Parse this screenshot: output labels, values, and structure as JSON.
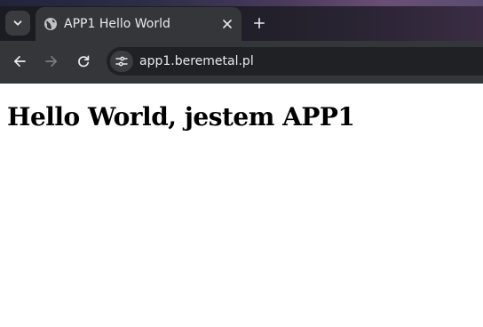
{
  "tabs": [
    {
      "title": "APP1 Hello World",
      "favicon": "globe-icon",
      "active": true
    }
  ],
  "toolbar": {
    "url": "app1.beremetal.pl"
  },
  "icons": {
    "tab_search": "chevron-down-icon",
    "close_tab": "close-icon",
    "new_tab": "plus-icon",
    "back": "arrow-left-icon",
    "forward": "arrow-right-icon",
    "reload": "reload-icon",
    "site_info": "tune-icon"
  },
  "colors": {
    "tab_strip": "#1c1d24",
    "toolbar": "#35363a",
    "omnibox": "#202124",
    "text_light": "#e8eaed",
    "icon_disabled": "#7a7c80"
  },
  "page": {
    "heading": "Hello World, jestem APP1"
  }
}
